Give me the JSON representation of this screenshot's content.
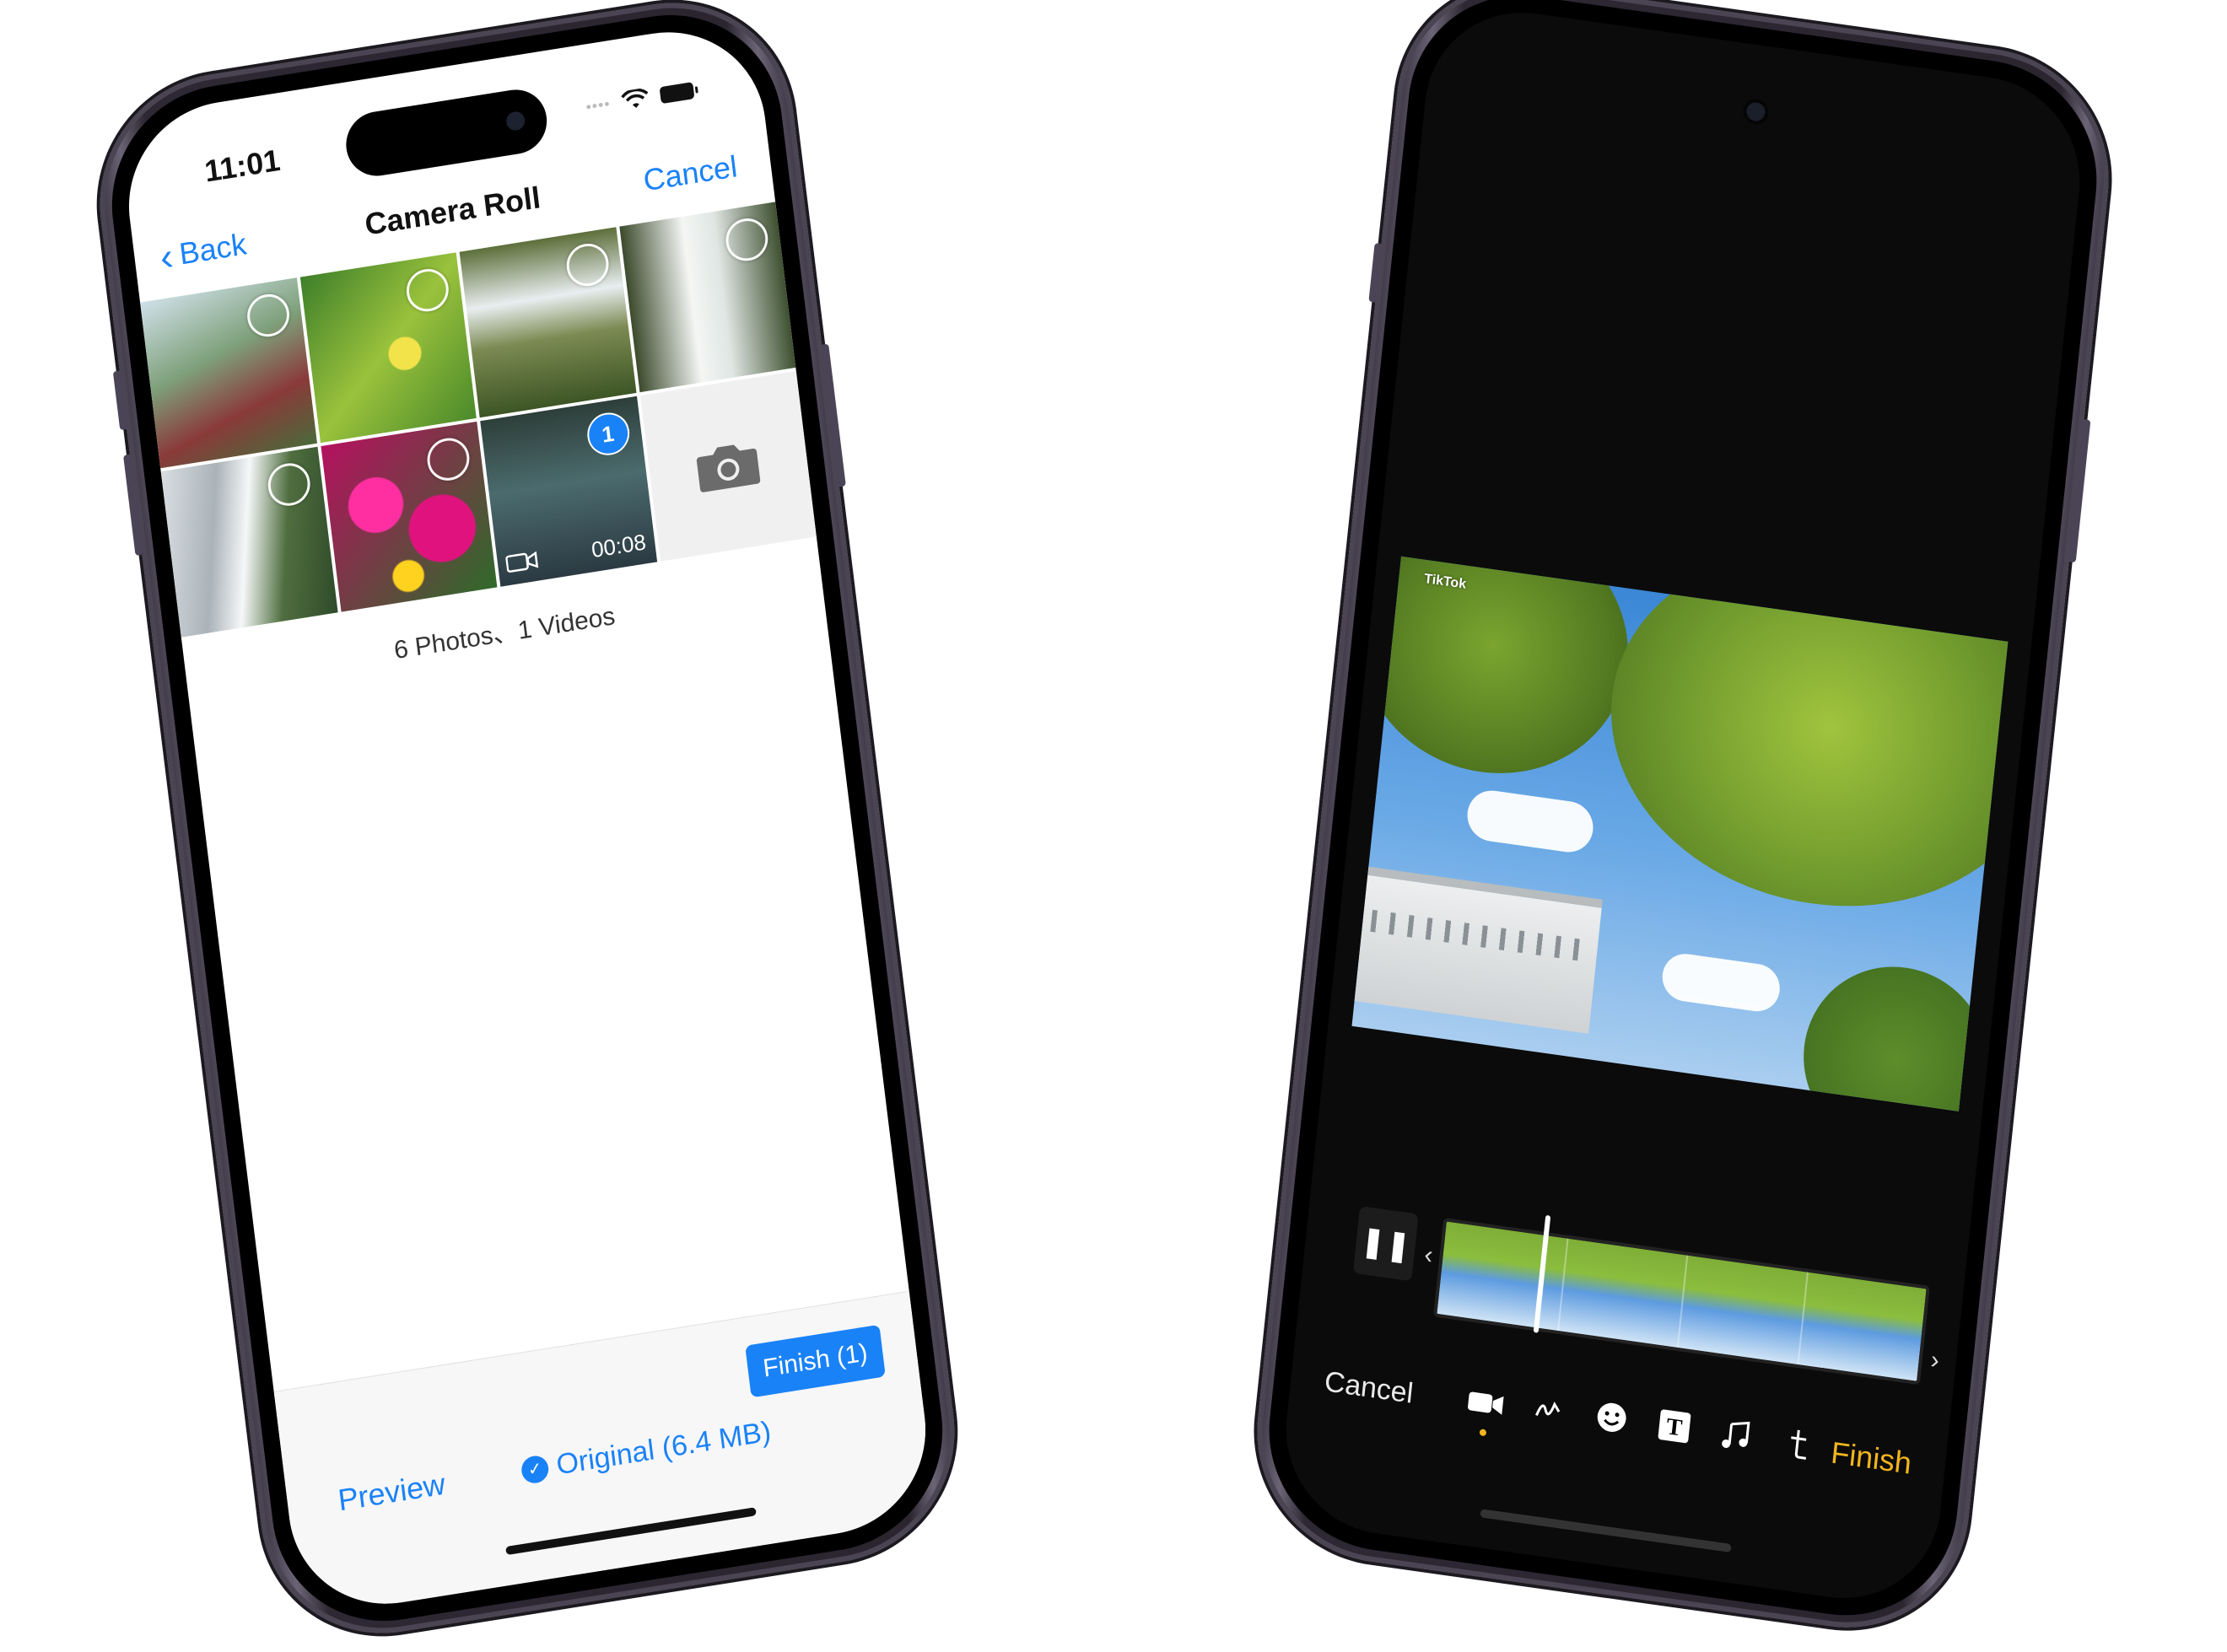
{
  "left_phone": {
    "status": {
      "time": "11:01",
      "dots": "••••"
    },
    "nav": {
      "back_label": "Back",
      "title": "Camera Roll",
      "cancel_label": "Cancel"
    },
    "grid": {
      "selected_badge": "1",
      "video_duration": "00:08"
    },
    "summary": "6 Photos、1 Videos",
    "bottom": {
      "preview_label": "Preview",
      "original_label": "Original (6.4 MB)",
      "finish_label": "Finish (1)"
    }
  },
  "right_phone": {
    "watermark": "TikTok",
    "toolbar": {
      "cancel_label": "Cancel",
      "finish_label": "Finish",
      "tools": [
        "video-icon",
        "draw-icon",
        "sticker-icon",
        "text-icon",
        "music-icon",
        "clip-icon"
      ]
    },
    "colors": {
      "accent": "#f2b51e"
    }
  },
  "colors": {
    "ios_blue": "#1a82f7"
  }
}
